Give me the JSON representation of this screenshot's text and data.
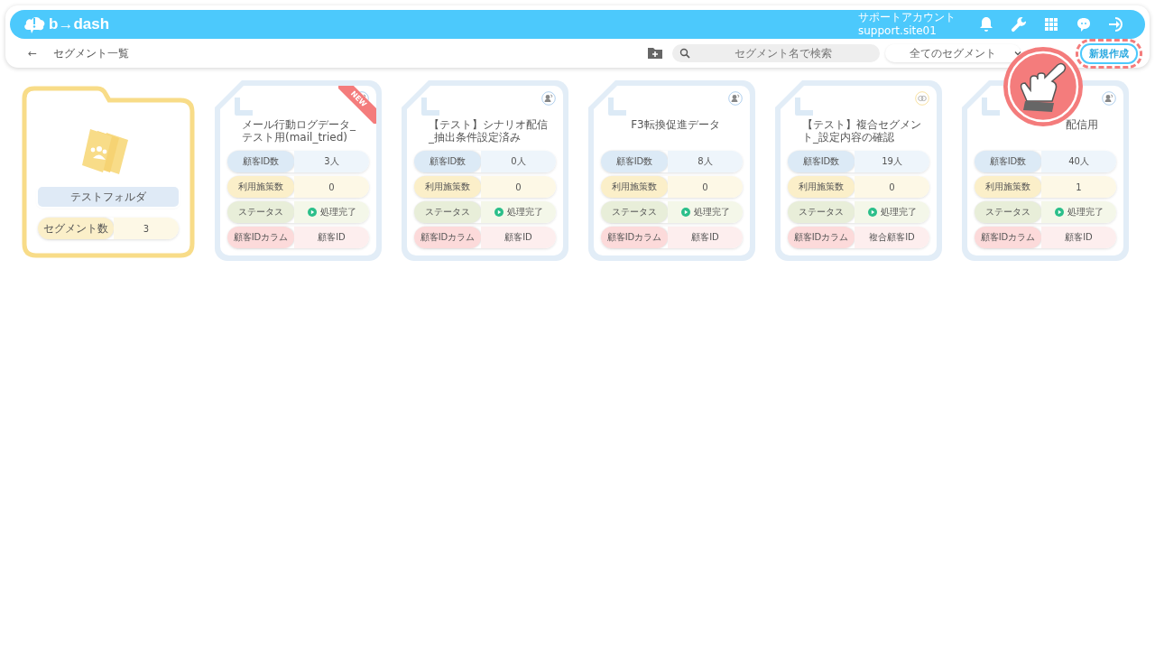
{
  "header": {
    "logo": "b→dash",
    "account_name": "サポートアカウント",
    "account_id": "support.site01"
  },
  "toolbar": {
    "back": "←",
    "page_title": "セグメント一覧",
    "search": {
      "placeholder": "セグメント名で検索"
    },
    "filter": {
      "value": "全てのセグメント"
    },
    "new_button": {
      "label": "新規作成",
      "highlighted": true
    }
  },
  "folder": {
    "name": "テストフォルダ",
    "count_label": "セグメント数",
    "count": "3"
  },
  "segments": [
    {
      "title": "メール行動ログデータ_テスト用(mail_tried)",
      "badge": "NEW",
      "kind": "person",
      "rows": [
        {
          "kind": "count",
          "label": "顧客ID数",
          "value": "3人"
        },
        {
          "kind": "measures",
          "label": "利用施策数",
          "value": "0"
        },
        {
          "kind": "status",
          "label": "ステータス",
          "value": "処理完了"
        },
        {
          "kind": "column",
          "label": "顧客IDカラム",
          "value": "顧客ID"
        }
      ]
    },
    {
      "title": "【テスト】シナリオ配信_抽出条件設定済み",
      "kind": "person",
      "rows": [
        {
          "kind": "count",
          "label": "顧客ID数",
          "value": "0人"
        },
        {
          "kind": "measures",
          "label": "利用施策数",
          "value": "0"
        },
        {
          "kind": "status",
          "label": "ステータス",
          "value": "処理完了"
        },
        {
          "kind": "column",
          "label": "顧客IDカラム",
          "value": "顧客ID"
        }
      ]
    },
    {
      "title": "F3転換促進データ",
      "kind": "person",
      "rows": [
        {
          "kind": "count",
          "label": "顧客ID数",
          "value": "8人"
        },
        {
          "kind": "measures",
          "label": "利用施策数",
          "value": "0"
        },
        {
          "kind": "status",
          "label": "ステータス",
          "value": "処理完了"
        },
        {
          "kind": "column",
          "label": "顧客IDカラム",
          "value": "顧客ID"
        }
      ]
    },
    {
      "title": "【テスト】複合セグメント_設定内容の確認",
      "kind": "composite",
      "rows": [
        {
          "kind": "count",
          "label": "顧客ID数",
          "value": "19人"
        },
        {
          "kind": "measures",
          "label": "利用施策数",
          "value": "0"
        },
        {
          "kind": "status",
          "label": "ステータス",
          "value": "処理完了"
        },
        {
          "kind": "column",
          "label": "顧客IDカラム",
          "value": "複合顧客ID"
        }
      ]
    },
    {
      "title": "配信用",
      "covered": true,
      "kind": "person",
      "rows": [
        {
          "kind": "count",
          "label": "顧客ID数",
          "value": "40人"
        },
        {
          "kind": "measures",
          "label": "利用施策数",
          "value": "1"
        },
        {
          "kind": "status",
          "label": "ステータス",
          "value": "処理完了"
        },
        {
          "kind": "column",
          "label": "顧客IDカラム",
          "value": "顧客ID"
        }
      ]
    }
  ],
  "pointer_overlay": {
    "kind": "hand"
  }
}
